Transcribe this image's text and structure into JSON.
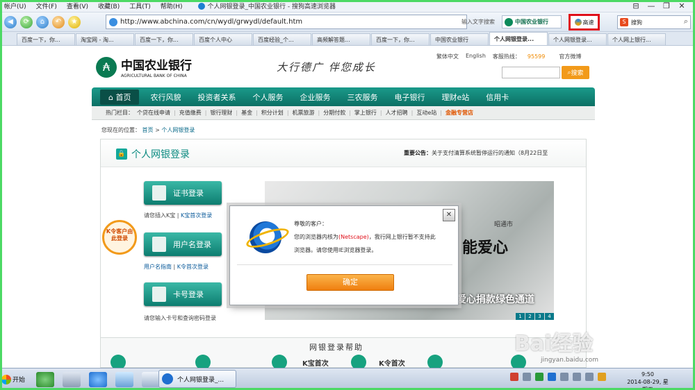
{
  "menubar": {
    "items": [
      "帐户(U)",
      "文件(F)",
      "查看(V)",
      "收藏(B)",
      "工具(T)",
      "帮助(H)"
    ],
    "window_title": "个人网银登录_中国农业银行 - 搜狗高速浏览器",
    "window_controls": [
      "⊟",
      "—",
      "❐",
      "✕"
    ]
  },
  "navbar": {
    "url": "http://www.abchina.com/cn/wydl/grwydl/default.htm",
    "input_hint": "输入文字搜索",
    "favorite_label": "中国农业银行",
    "high_speed_label": "高速",
    "search_engine": "搜狗"
  },
  "tabs": [
    {
      "label": "百度一下，你..."
    },
    {
      "label": "淘宝网 - 淘..."
    },
    {
      "label": "百度一下，你..."
    },
    {
      "label": "百度个人中心"
    },
    {
      "label": "百度经验_个..."
    },
    {
      "label": "高频解答题..."
    },
    {
      "label": "百度一下，你..."
    },
    {
      "label": "中国农业银行"
    },
    {
      "label": "个人网银登录..."
    },
    {
      "label": "个人网银登录..."
    },
    {
      "label": "个人网上银行..."
    }
  ],
  "active_tab_index": 8,
  "site": {
    "top_links": [
      "繁体中文",
      "English",
      "客服热线：",
      "95599",
      "官方微博"
    ],
    "logo_cn": "中国农业银行",
    "logo_en": "AGRICULTURAL BANK OF CHINA",
    "slogan": "大行德广  伴您成长",
    "search_button": "搜索",
    "main_nav": [
      "首页",
      "农行风貌",
      "投资者关系",
      "个人服务",
      "企业服务",
      "三农服务",
      "电子银行",
      "理财e站",
      "信用卡"
    ],
    "hot_label": "热门栏目：",
    "hot_items": [
      "个贷在线申请",
      "充值缴费",
      "银行理财",
      "基金",
      "积分计划",
      "机票旅游",
      "分期付款",
      "掌上银行",
      "人才招聘",
      "互动e站"
    ],
    "hot_highlight": "金融专营店",
    "breadcrumb_label": "您现在的位置：",
    "breadcrumb_home": "首页",
    "breadcrumb_sep": ">",
    "breadcrumb_current": "个人网银登录"
  },
  "panel": {
    "title": "个人网银登录",
    "notice_label": "重要公告：",
    "notice_text": "关于支付清算系统暂停运行的通知（8月22日至",
    "cert_login": "证书登录",
    "cert_sub_a": "请您插入K宝",
    "cert_sub_b": "K宝首次登录",
    "username_login": "用户名登录",
    "username_sub_a": "用户名指南",
    "username_sub_b": "K令首次登录",
    "card_login": "卡号登录",
    "card_sub": "请您输入卡号和查询密码登录",
    "kling_badge": "K令客户由此登录",
    "banner_text": "能爱心",
    "banner_sub": "爱心捐款绿色通道",
    "banner_city": "昭通市",
    "banner_pages": [
      "1",
      "2",
      "3",
      "4"
    ]
  },
  "help": {
    "title": "网银登录帮助",
    "items": [
      "K宝首次",
      "K令首次"
    ]
  },
  "dialog": {
    "greeting": "尊敬的客户：",
    "msg_a": "您的浏览器内核为",
    "msg_kernel": "(Netscape)",
    "msg_b": "，我行网上银行暂不支持此浏览器。请您使用IE浏览器登录。",
    "ok_label": "确定",
    "close_label": "✕"
  },
  "taskbar": {
    "start_label": "开始",
    "task_label": "个人网银登录_...",
    "time": "9:50",
    "date": "2014-08-29, 星期五"
  },
  "watermark": {
    "brand": "Bai经验",
    "url": "jingyan.baidu.com"
  }
}
